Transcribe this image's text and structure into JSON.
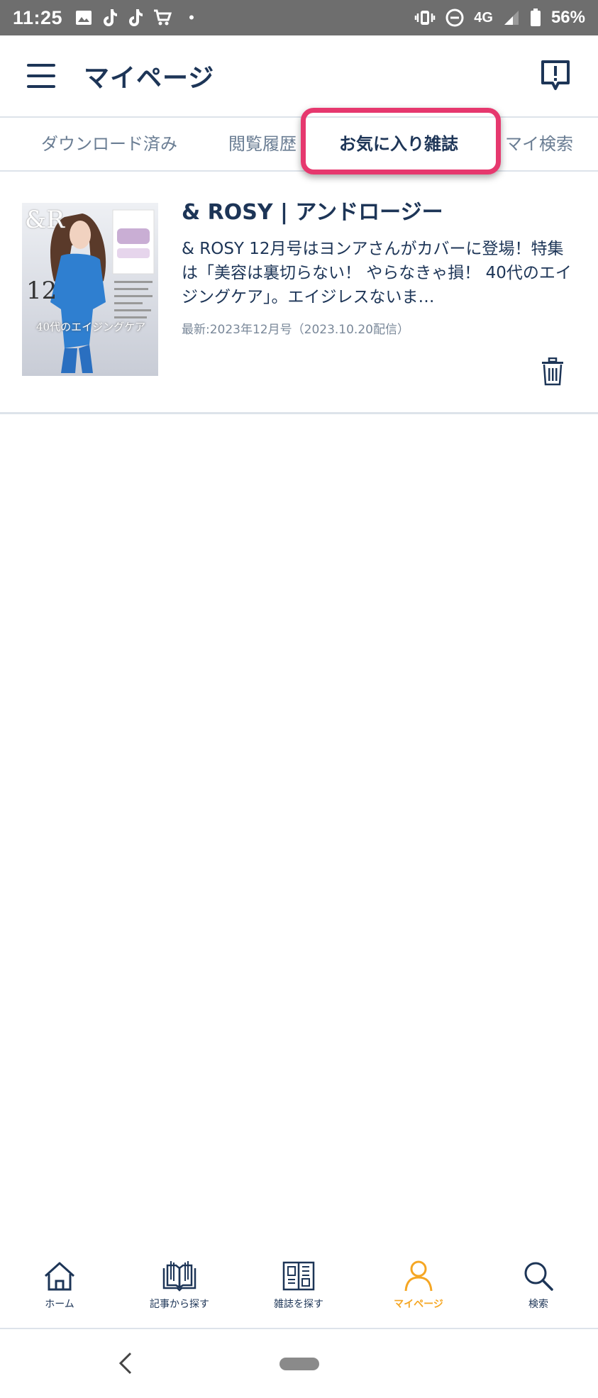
{
  "status_bar": {
    "time": "11:25",
    "network": "4G",
    "battery": "56%",
    "dot": "•",
    "icons": [
      "image-icon",
      "tiktok-icon",
      "tiktok-icon",
      "cart-icon",
      "vibrate-icon",
      "do-not-disturb-icon",
      "signal-icon",
      "battery-icon"
    ]
  },
  "header": {
    "title": "マイページ",
    "icons": [
      "menu-icon",
      "feedback-icon"
    ]
  },
  "tabs": [
    {
      "label": "ダウンロード済み"
    },
    {
      "label": "閲覧履歴"
    },
    {
      "label": "お気に入り雑誌",
      "active": true
    },
    {
      "label": "マイ検索"
    }
  ],
  "favorites": [
    {
      "title": "& ROSY | アンドロージー",
      "description": "& ROSY 12月号はヨンアさんがカバーに登場！特集は「美容は裏切らない！ やらなきゃ損！ 40代のエイジングケア」。エイジレスないま…",
      "latest": "最新:2023年12月号（2023.10.20配信）",
      "cover": {
        "logo": "&R",
        "issue": "12",
        "headline": "40代のエイジングケア"
      }
    }
  ],
  "bottom_nav": [
    {
      "label": "ホーム",
      "icon": "home-icon"
    },
    {
      "label": "記事から探す",
      "icon": "open-book-icon"
    },
    {
      "label": "雑誌を探す",
      "icon": "magazine-icon"
    },
    {
      "label": "マイページ",
      "icon": "person-icon",
      "active": true
    },
    {
      "label": "検索",
      "icon": "search-icon"
    }
  ],
  "colors": {
    "primary": "#1d3557",
    "active_nav": "#f5a623",
    "tab_highlight": "#e6386e",
    "inactive_tab": "#6a7d93",
    "status_bar": "#6e6e6e"
  }
}
